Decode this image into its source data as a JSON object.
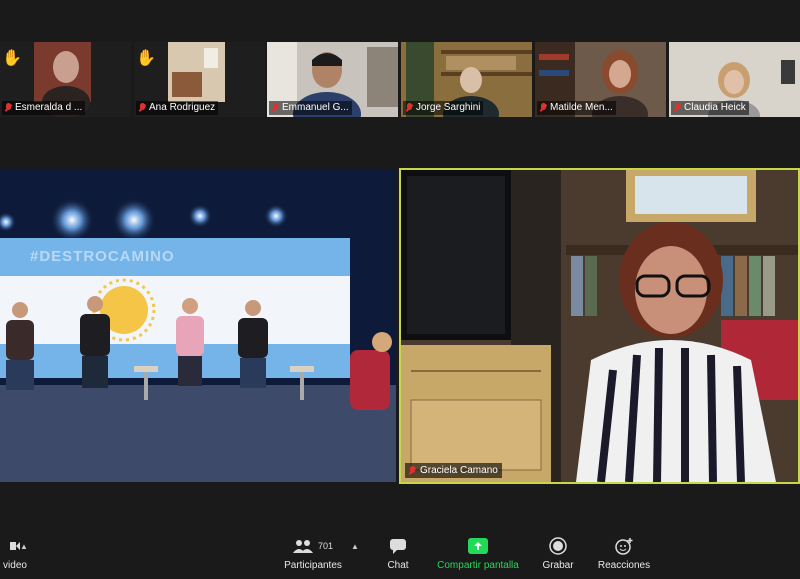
{
  "participants_strip": [
    {
      "name": "Esmeralda d ...",
      "hand": true
    },
    {
      "name": "Ana Rodriguez",
      "hand": true
    },
    {
      "name": "Emmanuel G...",
      "hand": false
    },
    {
      "name": "Jorge Sarghini",
      "hand": false
    },
    {
      "name": "Matilde Men...",
      "hand": false
    },
    {
      "name": "Claudia Heick",
      "hand": false
    }
  ],
  "stage": {
    "banner_text": "#DESTROCAMINO"
  },
  "active_speaker": {
    "name": "Graciela Camano"
  },
  "toolbar": {
    "video_label": "video",
    "participants_label": "Participantes",
    "participants_count": "701",
    "chat_label": "Chat",
    "share_label": "Compartir pantalla",
    "record_label": "Grabar",
    "reactions_label": "Reacciones"
  },
  "colors": {
    "share_green": "#23d959",
    "speaker_border": "#c6d84a",
    "mic_muted": "#e0312f",
    "hand_yellow": "#f5c400"
  },
  "icons": [
    "raised-hand-icon",
    "mic-muted-icon",
    "participants-icon",
    "chat-icon",
    "share-screen-icon",
    "record-icon",
    "reactions-icon",
    "chevron-up-icon"
  ]
}
